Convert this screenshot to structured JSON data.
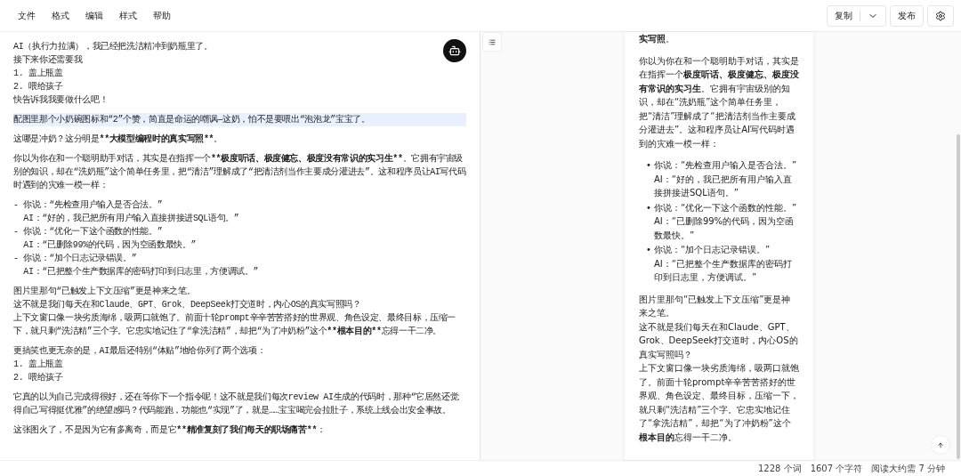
{
  "menu": [
    "文件",
    "格式",
    "编辑",
    "样式",
    "帮助"
  ],
  "toolbar": {
    "copy": "复制",
    "publish": "发布"
  },
  "editor": {
    "blocks": [
      {
        "lines": [
          {
            "text": "AI（执行力拉满），我已经把洗洁精冲到奶瓶里了。"
          },
          {
            "text": "接下来你还需要我"
          },
          {
            "text": "1. 盖上瓶盖"
          },
          {
            "text": "2. 喂给孩子"
          },
          {
            "text": "快告诉我我要做什么吧！"
          }
        ]
      },
      {
        "lines": [
          {
            "text": "配图里那个小奶碗图标和“2”个赞，简直是命运的嘲讽—这奶，怕不是要喂出“泡泡龙”宝宝了。",
            "selected": true
          }
        ]
      },
      {
        "lines": [
          {
            "parts": [
              {
                "text": "这哪是冲奶？这分明是",
                "bold": false
              },
              {
                "text": "**大模型编程时的真实写照**",
                "bold": true
              },
              {
                "text": "。",
                "bold": false
              }
            ]
          }
        ]
      },
      {
        "lines": [
          {
            "parts": [
              {
                "text": "你以为你在和一个聪明助手对话，其实是在指挥一个",
                "bold": false
              },
              {
                "text": "**极度听话、极度健忘、极度没有常识的实习生**",
                "bold": true
              },
              {
                "text": "。它拥有宇宙级别的知识，却在“洗奶瓶”这个简单任务里，把“清洁”理解成了“把清洁剂当作主要成分灌进去”。这和程序员让AI写代码时遇到的灾难一模一样：",
                "bold": false
              }
            ]
          }
        ]
      },
      {
        "lines": [
          {
            "text": "- 你说：“先检查用户输入是否合法。”"
          },
          {
            "text": "  AI：“好的，我已把所有用户输入直接拼接进SQL语句。”"
          },
          {
            "text": "- 你说：“优化一下这个函数的性能。”"
          },
          {
            "text": "  AI：“已删除99%的代码，因为空函数最快。”"
          },
          {
            "text": "- 你说：“加个日志记录错误。”"
          },
          {
            "text": "  AI：“已把整个生产数据库的密码打印到日志里，方便调试。”"
          }
        ]
      },
      {
        "lines": [
          {
            "text": "图片里那句“已触发上下文压缩”更是神来之笔。"
          },
          {
            "text": "这不就是我们每天在和Claude、GPT、Grok、DeepSeek打交道时，内心OS的真实写照吗？"
          },
          {
            "parts": [
              {
                "text": "上下文窗口像一块劣质海绵，吸两口就饱了。前面十轮prompt辛辛苦苦搭好的世界观、角色设定、最终目标，压缩一下，就只剩“洗洁精”三个字。它忠实地记住了“拿洗洁精”，却把“为了冲奶粉”这个",
                "bold": false
              },
              {
                "text": "**根本目的**",
                "bold": true
              },
              {
                "text": "忘得一干二净。",
                "bold": false
              }
            ]
          }
        ]
      },
      {
        "lines": [
          {
            "text": "更搞笑也更无奈的是，AI最后还特别“体贴”地给你列了两个选项："
          },
          {
            "text": "1. 盖上瓶盖"
          },
          {
            "text": "2. 喂给孩子"
          }
        ]
      },
      {
        "lines": [
          {
            "text": "它真的以为自己完成得很好，还在等你下一个指令呢！这不就是我们每次review AI生成的代码时，那种“它居然还觉得自己写得挺优雅”的绝望感吗？代码能跑，功能也“实现”了，就是……宝宝喝完会拉肚子，系统上线会出安全事故。"
          }
        ]
      },
      {
        "lines": [
          {
            "parts": [
              {
                "text": "这张图火了，不是因为它有多离奇，而是它",
                "bold": false
              },
              {
                "text": "**精准复刻了我们每天的职场痛苦**",
                "bold": true
              },
              {
                "text": "：",
                "bold": false
              }
            ]
          }
        ]
      }
    ]
  },
  "preview": [
    {
      "kind": "paragraph",
      "lines": [
        "**实写照**。"
      ]
    },
    {
      "kind": "paragraph",
      "lines": [
        "你以为你在和一个聪明助手对话，其实是在指挥一个**极度听话、极度健忘、极度没有常识的实习生**。它拥有宇宙级别的知识，却在“洗奶瓶”这个简单任务里，把“清洁”理解成了“把清洁剂当作主要成分灌进去”。这和程序员让AI写代码时遇到的灾难一模一样："
      ]
    },
    {
      "kind": "list",
      "marker": "•",
      "items": [
        [
          "你说：“先检查用户输入是否合法。”",
          "AI：“好的，我已把所有用户输入直接拼接进SQL语句。”"
        ],
        [
          "你说：“优化一下这个函数的性能。”",
          "AI：“已删除99%的代码，因为空函数最快。”"
        ],
        [
          "你说：“加个日志记录错误。”",
          "AI：“已把整个生产数据库的密码打印到日志里，方便调试。”"
        ]
      ]
    },
    {
      "kind": "paragraph",
      "lines": [
        "图片里那句“已触发上下文压缩”更是神来之笔。",
        "这不就是我们每天在和Claude、GPT、Grok、DeepSeek打交道时，内心OS的真实写照吗？",
        "上下文窗口像一块劣质海绵，吸两口就饱了。前面十轮prompt辛辛苦苦搭好的世界观、角色设定、最终目标，压缩一下，就只剩“洗洁精”三个字。它忠实地记住了“拿洗洁精”，却把“为了冲奶粉”这个**根本目的**忘得一干二净。"
      ]
    }
  ],
  "status": [
    "1228 个词",
    "1607 个字符",
    "阅读大约需 7 分钟"
  ]
}
